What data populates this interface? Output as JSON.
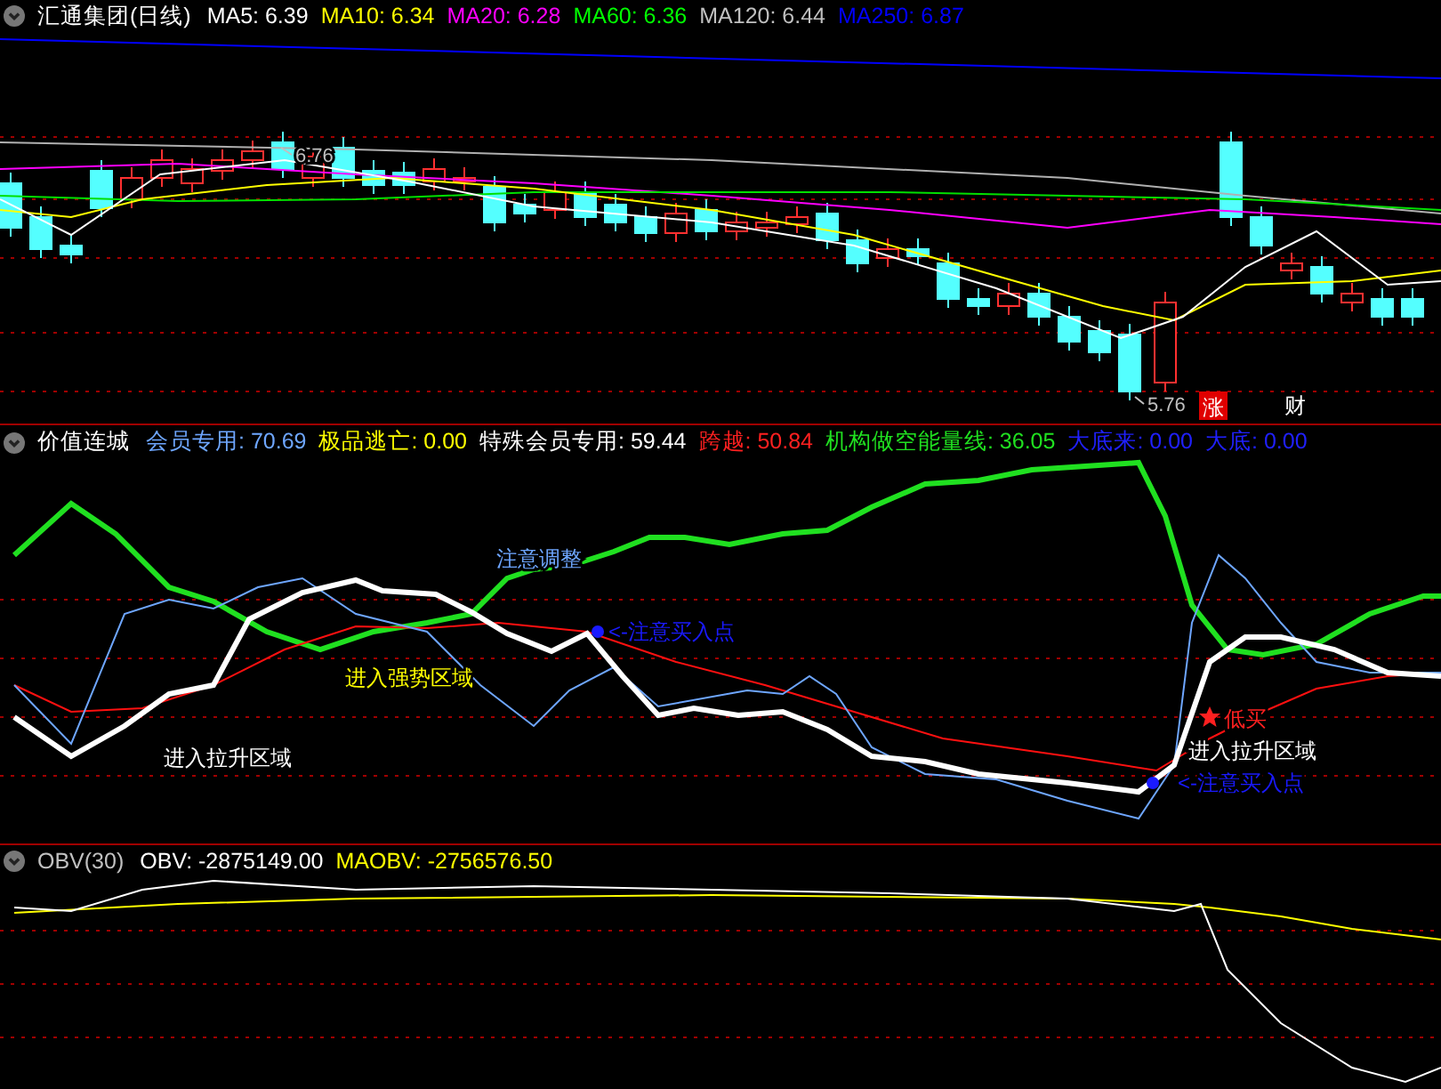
{
  "panels": [
    {
      "title": "汇通集团(日线)",
      "legend": [
        {
          "text": "MA5: 6.39",
          "color": "#ffffff"
        },
        {
          "text": "MA10: 6.34",
          "color": "#ffff00"
        },
        {
          "text": "MA20: 6.28",
          "color": "#ff00ff"
        },
        {
          "text": "MA60: 6.36",
          "color": "#00ff00"
        },
        {
          "text": "MA120: 6.44",
          "color": "#c0c0c0"
        },
        {
          "text": "MA250: 6.87",
          "color": "#0000ff"
        }
      ],
      "annotations": [
        {
          "kind": "price",
          "text": "6.76",
          "color": "#c0c0c0"
        },
        {
          "kind": "price",
          "text": "5.76",
          "color": "#c0c0c0"
        },
        {
          "kind": "badge",
          "text": "涨",
          "color": "#e00000"
        },
        {
          "kind": "label",
          "text": "财",
          "color": "#ffffff"
        }
      ]
    },
    {
      "title": "价值连城",
      "legend": [
        {
          "text": "会员专用: 70.69",
          "color": "#6ea6ff"
        },
        {
          "text": "极品逃亡: 0.00",
          "color": "#ffff00"
        },
        {
          "text": "特殊会员专用: 59.44",
          "color": "#ffffff"
        },
        {
          "text": "跨越: 50.84",
          "color": "#ff2020"
        },
        {
          "text": "机构做空能量线: 36.05",
          "color": "#20e020"
        },
        {
          "text": "大底来: 0.00",
          "color": "#2020ff"
        },
        {
          "text": "大底: 0.00",
          "color": "#2020ff"
        }
      ],
      "annotations": [
        {
          "kind": "label",
          "text": "注意调整",
          "color": "#6ea6ff"
        },
        {
          "kind": "label",
          "text": "进入强势区域",
          "color": "#ffff00"
        },
        {
          "kind": "label",
          "text": "进入拉升区域",
          "color": "#ffffff"
        },
        {
          "kind": "point",
          "text": "<-注意买入点",
          "color": "#1a1aff"
        },
        {
          "kind": "star",
          "text": "低买",
          "color": "#ff2020"
        },
        {
          "kind": "label",
          "text": "进入拉升区域",
          "color": "#ffffff"
        },
        {
          "kind": "point",
          "text": "<-注意买入点",
          "color": "#1a1aff"
        }
      ]
    },
    {
      "title": "OBV(30)",
      "legend": [
        {
          "text": "OBV: -2875149.00",
          "color": "#ffffff"
        },
        {
          "text": "MAOBV: -2756576.50",
          "color": "#ffff00"
        }
      ]
    }
  ]
}
